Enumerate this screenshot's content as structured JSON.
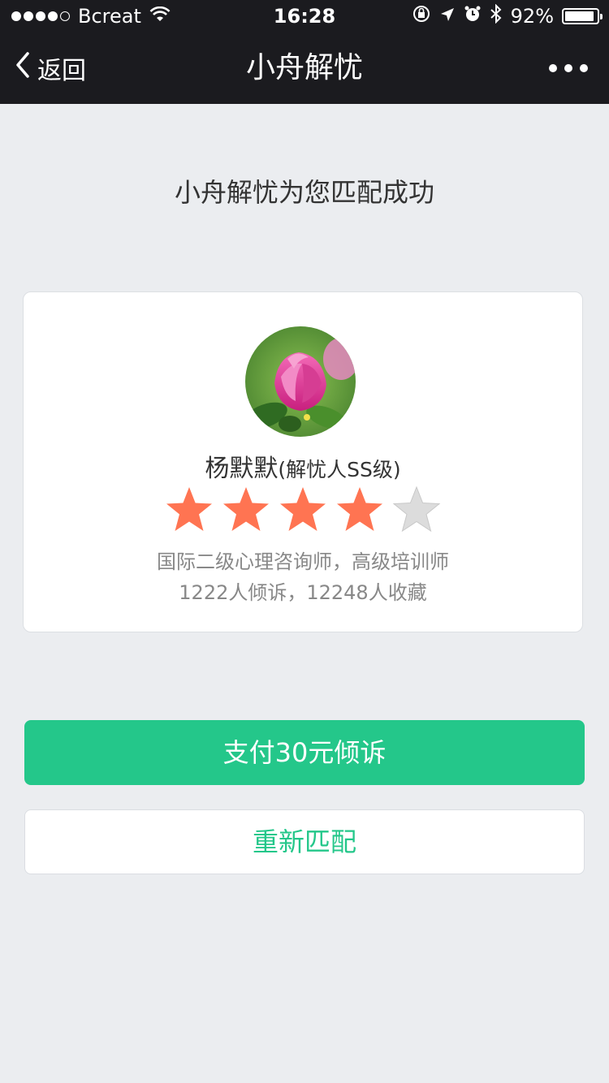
{
  "status_bar": {
    "carrier": "Bcreat",
    "time": "16:28",
    "battery_text": "92%",
    "battery_level": 0.92,
    "signal_bars_filled": 4,
    "signal_bars_total": 5
  },
  "nav": {
    "back_label": "返回",
    "title": "小舟解忧"
  },
  "match_title": "小舟解忧为您匹配成功",
  "counselor": {
    "name": "杨默默",
    "level": "(解忧人SS级)",
    "rating": 4,
    "rating_max": 5,
    "title_line": "国际二级心理咨询师，高级培训师",
    "stats_line": "1222人倾诉，12248人收藏"
  },
  "buttons": {
    "pay_label": "支付30元倾诉",
    "rematch_label": "重新匹配"
  },
  "colors": {
    "accent": "#24c78a",
    "star_filled": "#ff7452",
    "star_empty": "#dcdcdc",
    "header_bg": "#1b1b1f"
  }
}
